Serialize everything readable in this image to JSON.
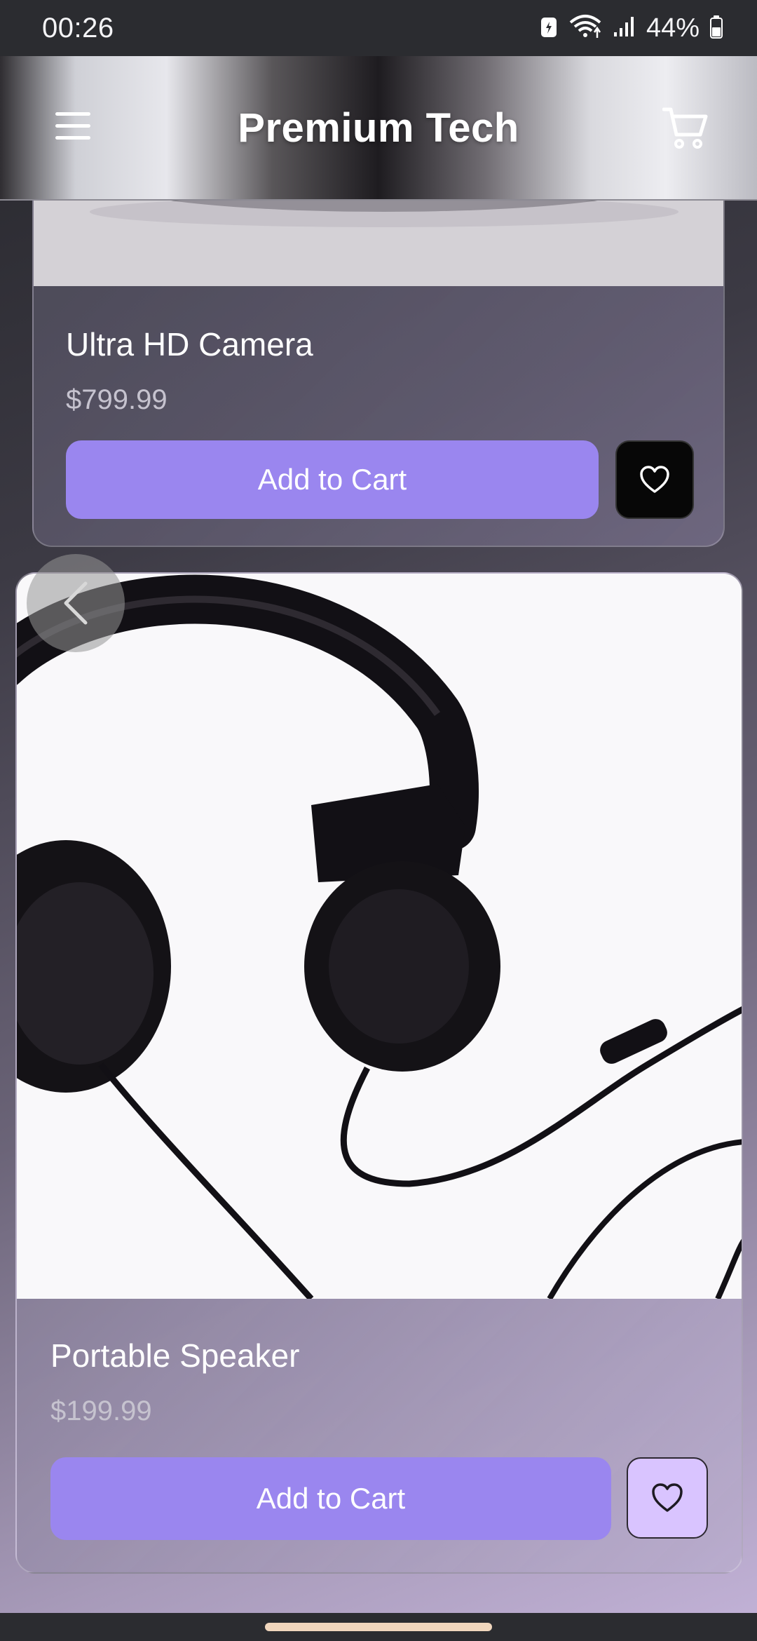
{
  "status_bar": {
    "time": "00:26",
    "battery": "44%",
    "icons": [
      "battery-saver-icon",
      "wifi-icon",
      "signal-icon",
      "battery-icon"
    ]
  },
  "header": {
    "title": "Premium Tech",
    "menu_icon": "hamburger-menu-icon",
    "cart_icon": "shopping-cart-icon"
  },
  "products": [
    {
      "name": "Ultra HD Camera",
      "price": "$799.99",
      "button_label": "Add to Cart",
      "favorite_icon": "heart-icon"
    },
    {
      "name": "Portable Speaker",
      "price": "$199.99",
      "button_label": "Add to Cart",
      "favorite_icon": "heart-icon"
    }
  ],
  "colors": {
    "accent": "#9a86ef",
    "favorite_active_bg": "#d9c4ff",
    "favorite_bg": "#070707"
  }
}
